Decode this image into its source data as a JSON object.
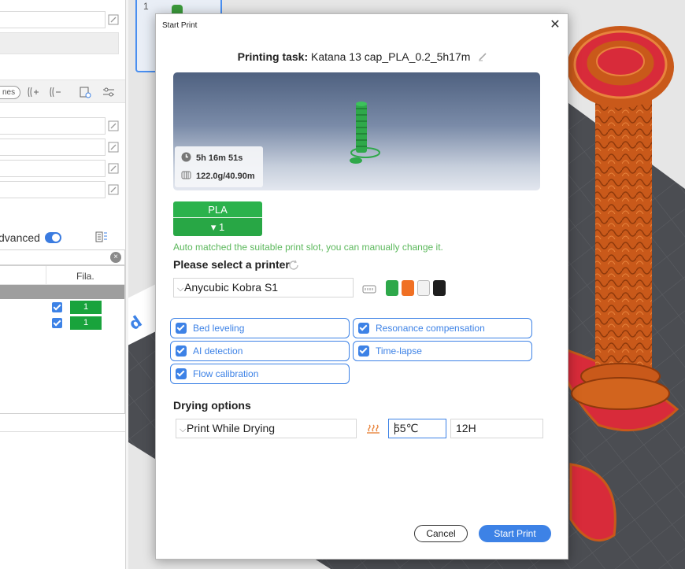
{
  "left_panel": {
    "pill_label": "nes",
    "advanced_label": "dvanced",
    "advanced_toggle_on": true,
    "search_clear_glyph": "×",
    "table": {
      "header_fila": "Fila.",
      "rows": [
        {
          "checked": true,
          "filament": "1"
        },
        {
          "checked": true,
          "filament": "1"
        }
      ]
    }
  },
  "viewport": {
    "plate_number": "1",
    "model_color": "#d2641e",
    "support_color": "#d82b3a",
    "bed_color": "#4b4d52"
  },
  "dialog": {
    "title": "Start Print",
    "close_glyph": "✕",
    "task_label": "Printing task:",
    "task_name": "Katana 13 cap_PLA_0.2_5h17m",
    "preview": {
      "time": "5h 16m 51s",
      "material": "122.0g/40.90m",
      "model_color": "#2fa84a"
    },
    "slot": {
      "material": "PLA",
      "slot_value": "1",
      "color": "#2bb24c"
    },
    "auto_match_note": "Auto matched the suitable print slot, you can manually change it.",
    "printer_section_label": "Please select a printer",
    "printer_selected": "Anycubic Kobra S1",
    "filament_swatches": [
      "#2ea84a",
      "#f07024",
      "#f2f2f2",
      "#1e1e1e"
    ],
    "options": [
      {
        "label": "Bed leveling",
        "checked": true
      },
      {
        "label": "Resonance compensation",
        "checked": true
      },
      {
        "label": "AI detection",
        "checked": true
      },
      {
        "label": "Time-lapse",
        "checked": true
      },
      {
        "label": "Flow calibration",
        "checked": true
      }
    ],
    "drying_section_label": "Drying options",
    "drying_mode": "Print While Drying",
    "drying_temp": "55℃",
    "drying_time": "12H",
    "cancel_label": "Cancel",
    "start_label": "Start Print",
    "accent_color": "#3d82e6"
  }
}
